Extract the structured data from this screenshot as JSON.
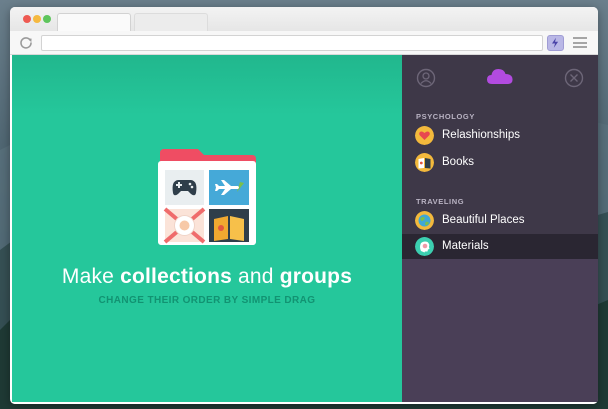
{
  "browser": {
    "colors": {
      "close": "#ee5a52",
      "minimize": "#f5b940",
      "zoom": "#5ec55c"
    },
    "tabs": [
      {
        "label": "",
        "active": true
      },
      {
        "label": "",
        "active": false
      }
    ],
    "address": "",
    "icons": [
      "reload-icon",
      "lightning-icon",
      "menu-icon"
    ]
  },
  "main": {
    "headline_prefix": "Make ",
    "headline_bold1": "collections",
    "headline_mid": " and ",
    "headline_bold2": "groups",
    "subline": "CHANGE THEIR ORDER BY SIMPLE DRAG",
    "accent_color": "#25c79b",
    "folder_tiles": [
      "gamepad-icon",
      "airplane-icon",
      "dinner-plate-icon",
      "book-icon"
    ]
  },
  "panel": {
    "header_icons": [
      "user-icon",
      "cloud-icon",
      "close-icon"
    ],
    "sections": [
      {
        "title": "PSYCHOLOGY",
        "items": [
          {
            "label": "Relashionships",
            "icon": "heart-icon",
            "selected": false
          },
          {
            "label": "Books",
            "icon": "book-icon",
            "selected": false
          }
        ]
      },
      {
        "title": "TRAVELING",
        "items": [
          {
            "label": "Beautiful Places",
            "icon": "globe-icon",
            "selected": false
          },
          {
            "label": "Materials",
            "icon": "brain-icon",
            "selected": true
          }
        ]
      }
    ],
    "background_color": "#3e3848",
    "cloud_color": "#b24be0"
  }
}
